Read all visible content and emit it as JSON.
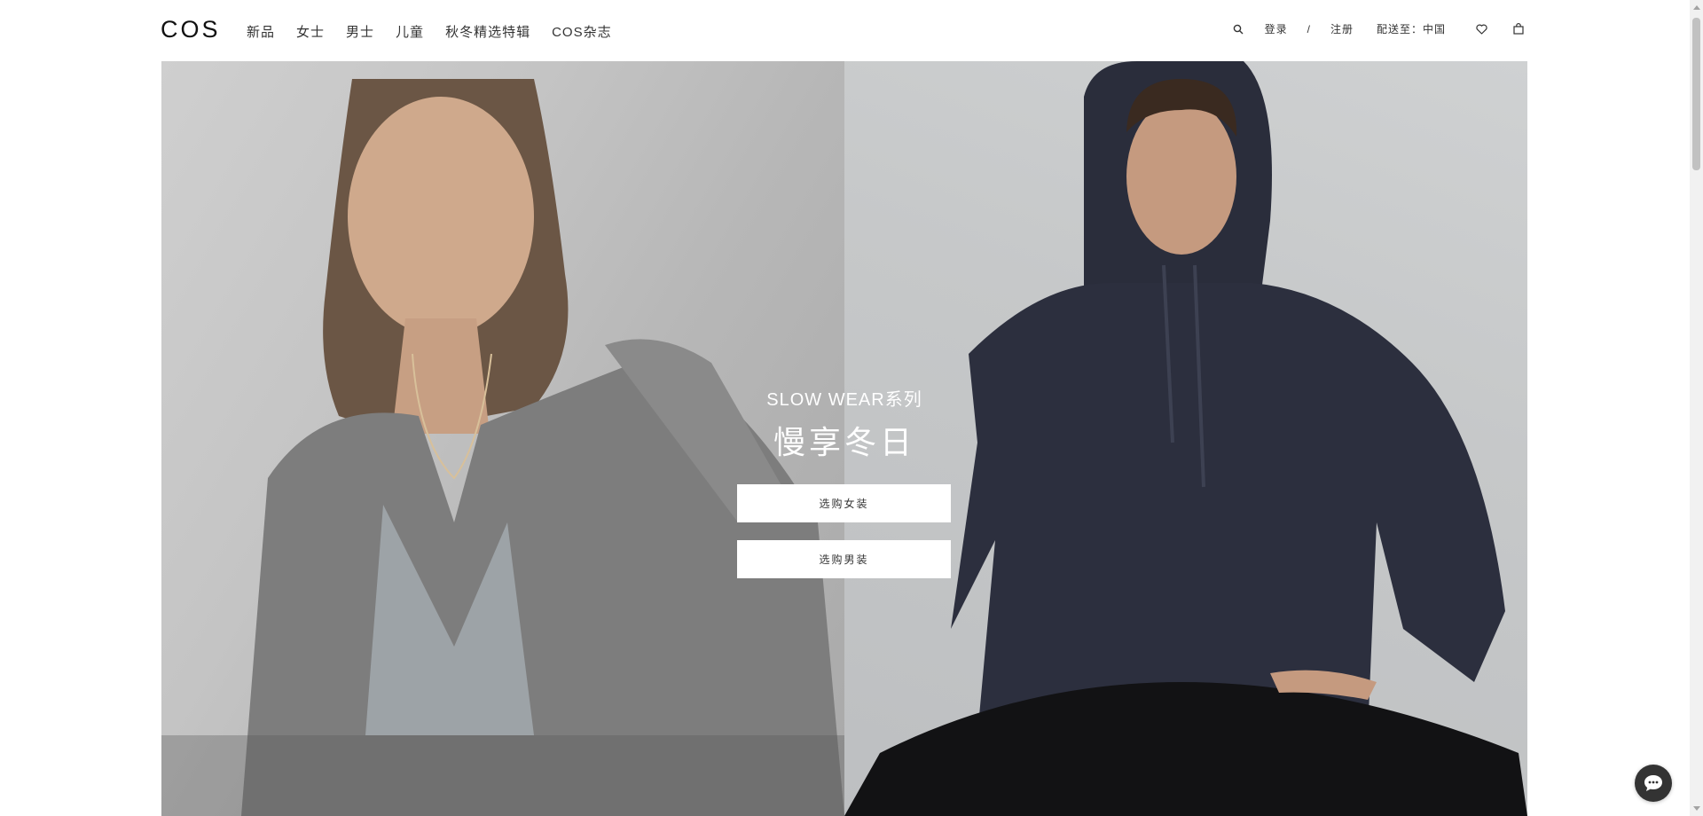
{
  "header": {
    "logo": "COS",
    "nav": [
      {
        "label": "新品"
      },
      {
        "label": "女士"
      },
      {
        "label": "男士"
      },
      {
        "label": "儿童"
      },
      {
        "label": "秋冬精选特辑"
      },
      {
        "label": "COS杂志"
      }
    ],
    "utility": {
      "search_icon": "search-icon",
      "login_label": "登录",
      "separator": "/",
      "register_label": "注册",
      "ship_to_label": "配送至：中国",
      "wishlist_icon": "heart-icon",
      "bag_icon": "shopping-bag-icon"
    }
  },
  "hero": {
    "eyebrow": "SLOW WEAR系列",
    "headline": "慢享冬日",
    "cta_women": "选购女装",
    "cta_men": "选购男装"
  },
  "chat": {
    "icon": "chat-bubble-icon"
  },
  "colors": {
    "header_bg": "#ffffff",
    "text": "#333333",
    "hero_text": "#ffffff",
    "button_bg": "#ffffff",
    "chat_bg": "#333333"
  }
}
